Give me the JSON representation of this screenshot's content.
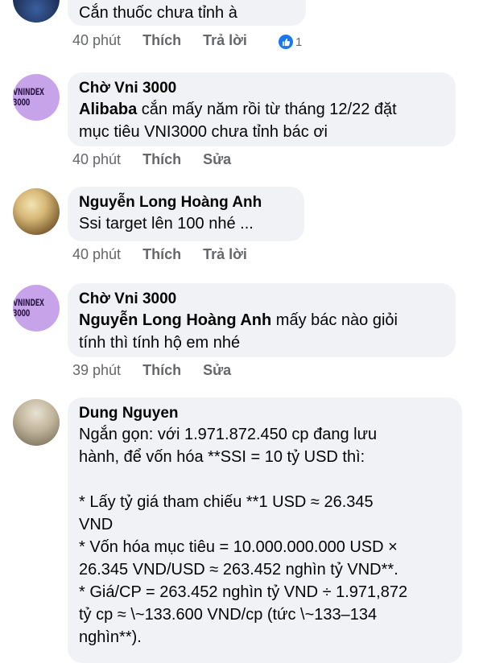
{
  "comments": [
    {
      "text": "Cắn thuốc chưa tỉnh à",
      "time": "40 phút",
      "like_label": "Thích",
      "reply_label": "Trả lời",
      "reaction_count": "1"
    },
    {
      "author": "Chờ Vni 3000",
      "mention": "Alibaba",
      "text_line1": " cắn mấy năm rồi từ tháng 12/22 đặt",
      "text_line2": "mục tiêu VNI3000 chưa tỉnh bác ơi",
      "time": "40 phút",
      "like_label": "Thích",
      "edit_label": "Sửa"
    },
    {
      "author": "Nguyễn Long Hoàng Anh",
      "text": "Ssi target lên 100 nhé ...",
      "time": "40 phút",
      "like_label": "Thích",
      "reply_label": "Trả lời"
    },
    {
      "author": "Chờ Vni 3000",
      "mention": "Nguyễn Long Hoàng Anh",
      "text_line1": "  mấy bác nào giỏi",
      "text_line2": "tính thì tính hộ em nhé",
      "time": "39 phút",
      "like_label": "Thích",
      "edit_label": "Sửa"
    },
    {
      "author": "Dung Nguyen",
      "lines": [
        "Ngắn gọn: với 1.971.872.450 cp đang lưu",
        "hành, để vốn hóa **SSI = 10 tỷ USD thì:",
        "",
        "* Lấy tỷ giá tham chiếu **1 USD ≈ 26.345",
        "VND",
        "* Vốn hóa mục tiêu = 10.000.000.000 USD ×",
        "26.345 VND/USD ≈ 263.452 nghìn tỷ VND**.",
        "* Giá/CP = 263.452 nghìn tỷ VND ÷ 1.971,872",
        "tỷ cp ≈ \\~133.600 VND/cp (tức \\~133–134",
        "nghìn**)."
      ]
    }
  ],
  "avatars": {
    "vnindex_text": "VNINDEX 3000"
  },
  "colors": {
    "bubble": "#f0f2f5",
    "meta_text": "#65676b",
    "like_blue": "#1877f2",
    "avatar_purple": "#c7a3ea"
  }
}
